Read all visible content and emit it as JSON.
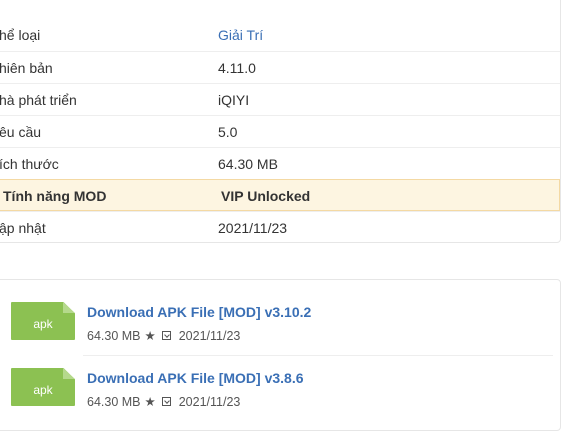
{
  "details": {
    "rows": [
      {
        "label": "hể loại",
        "value": "Giải Trí"
      },
      {
        "label": "hiên bản",
        "value": "4.11.0"
      },
      {
        "label": "hà phát triển",
        "value": "iQIYI"
      },
      {
        "label": "êu cầu",
        "value": "5.0"
      },
      {
        "label": "ích thước",
        "value": "64.30 MB"
      },
      {
        "label": "Tính năng MOD",
        "value": "VIP Unlocked"
      },
      {
        "label": "ập nhật",
        "value": "2021/11/23"
      }
    ]
  },
  "downloads": [
    {
      "icon_text": "apk",
      "title": "Download APK File [MOD] v3.10.2",
      "size": "64.30 MB",
      "star": "★",
      "date": "2021/11/23"
    },
    {
      "icon_text": "apk",
      "title": "Download APK File [MOD] v3.8.6",
      "size": "64.30 MB",
      "star": "★",
      "date": "2021/11/23"
    }
  ],
  "colors": {
    "link": "#3a6fb5",
    "apk_icon": "#8cc152",
    "mod_highlight_bg": "#fdf5e1",
    "mod_highlight_border": "#f4d9a3"
  }
}
